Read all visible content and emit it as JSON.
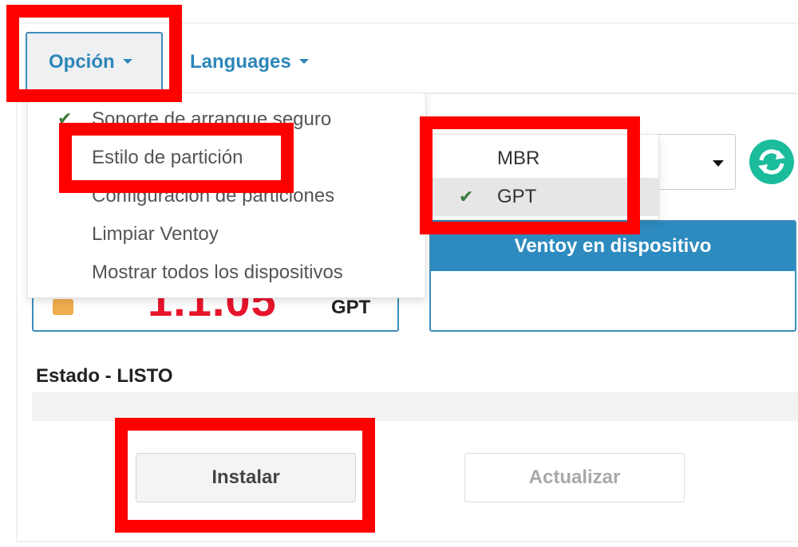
{
  "navbar": {
    "option_label": "Opción",
    "languages_label": "Languages"
  },
  "option_menu": {
    "items": [
      {
        "label": "Soporte de arranque seguro",
        "checked": true
      },
      {
        "label": "Estilo de partición",
        "checked": false
      },
      {
        "label": "Configuración de particiones",
        "checked": false
      },
      {
        "label": "Limpiar Ventoy",
        "checked": false
      },
      {
        "label": "Mostrar todos los dispositivos",
        "checked": false
      }
    ]
  },
  "partition_menu": {
    "items": [
      {
        "label": "MBR",
        "checked": false
      },
      {
        "label": "GPT",
        "checked": true
      }
    ]
  },
  "local_package": {
    "version": "1.1.05",
    "partition_style": "GPT"
  },
  "device_panel": {
    "header": "Ventoy en dispositivo"
  },
  "status": {
    "label": "Estado - LISTO"
  },
  "buttons": {
    "install": "Instalar",
    "update": "Actualizar"
  },
  "colors": {
    "accent": "#2e8bbf",
    "version_red": "#e8142c",
    "highlight": "#ff0000",
    "check_green": "#3a7a3a",
    "refresh_green": "#1abc9c"
  },
  "icons": {
    "check": "check-icon",
    "refresh": "refresh-icon",
    "folder": "folder-icon",
    "caret": "caret-down-icon"
  }
}
